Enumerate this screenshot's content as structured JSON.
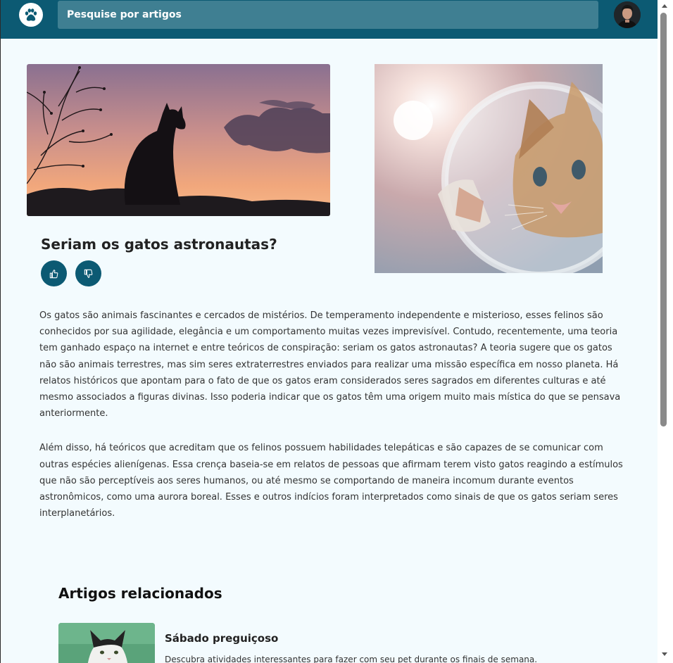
{
  "header": {
    "search_placeholder": "Pesquise por artigos",
    "logo_icon": "paw-icon",
    "accent_color": "#0c5a73"
  },
  "article": {
    "title": "Seriam os gatos astronautas?",
    "like_icon": "thumbs-up-icon",
    "dislike_icon": "thumbs-down-icon",
    "paragraphs": [
      "Os gatos são animais fascinantes e cercados de mistérios. De temperamento independente e misterioso, esses felinos são conhecidos por sua agilidade, elegância e um comportamento muitas vezes imprevisível. Contudo, recentemente, uma teoria tem ganhado espaço na internet e entre teóricos de conspiração: seriam os gatos astronautas? A teoria sugere que os gatos não são animais terrestres, mas sim seres extraterrestres enviados para realizar uma missão específica em nosso planeta. Há relatos históricos que apontam para o fato de que os gatos eram considerados seres sagrados em diferentes culturas e até mesmo associados a figuras divinas. Isso poderia indicar que os gatos têm uma origem muito mais mística do que se pensava anteriormente.",
      "Além disso, há teóricos que acreditam que os felinos possuem habilidades telepáticas e são capazes de se comunicar com outras espécies alienígenas. Essa crença baseia-se em relatos de pessoas que afirmam terem visto gatos reagindo a estímulos que não são perceptíveis aos seres humanos, ou até mesmo se comportando de maneira incomum durante eventos astronômicos, como uma aurora boreal. Esses e outros indícios foram interpretados como sinais de que os gatos seriam seres interplanetários."
    ]
  },
  "related": {
    "heading": "Artigos relacionados",
    "items": [
      {
        "title": "Sábado preguiçoso",
        "description": "Descubra atividades interessantes para fazer com seu pet durante os finais de semana."
      }
    ]
  }
}
